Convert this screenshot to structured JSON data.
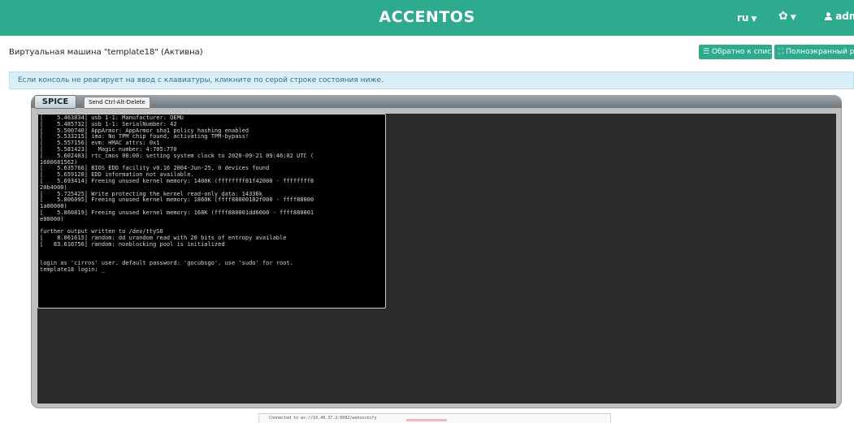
{
  "header": {
    "brand": "ACCENTOS",
    "lang": "ru",
    "caret": "▼",
    "gear": "✿",
    "user": "admi",
    "user_icon": "user-icon"
  },
  "page": {
    "title": "Виртуальная машина \"template18\" (Активна)",
    "back_button": "☰ Обратно к списку",
    "fullscreen_button": "⛶ Полноэкранный режим"
  },
  "alert": {
    "text": "Если консоль не реагирует на ввод с клавиатуры, кликните по серой строке состояния ниже."
  },
  "spice": {
    "logo": "SPICE",
    "cad_label": "Send Ctrl-Alt-Delete"
  },
  "console": {
    "lines": [
      "[    5.463834] usb 1-1: Manufacturer: QEMU",
      "[    5.485732] usb 1-1: SerialNumber: 42",
      "[    5.500740] AppArmor: AppArmor sha1 policy hashing enabled",
      "[    5.533215] ima: No TPM chip found, activating TPM-bypass!",
      "[    5.557156] evm: HMAC attrs: 0x1",
      "[    5.581423]   Magic number: 4:705:770",
      "[    5.602403] rtc_cmos 00:00: setting system clock to 2020-09-21 09:46:02 UTC (",
      "1600681562)",
      "[    5.635766] BIOS EDD facility v0.16 2004-Jun-25, 0 devices found",
      "[    5.659128] EDD information not available.",
      "[    5.693414] Freeing unused kernel memory: 1400K (ffffffff81f42000 - ffffffff8",
      "20b4000)",
      "[    5.725425] Write protecting the kernel read-only data: 14336k",
      "[    5.806095] Freeing unused kernel memory: 1860K (ffff88000182f000 - ffff88000",
      "1a00000)",
      "[    5.860819] Freeing unused kernel memory: 168K (ffff880001dd6000 - ffff880001",
      "e00000)",
      "",
      "further output written to /dev/ttyS0",
      "[    8.061615] random: dd urandom read with 20 bits of entropy available",
      "[   83.610756] random: nonblocking pool is initialized",
      "",
      "",
      "login as 'cirros' user. default password: 'gocubsgo'. use 'sudo' for root.",
      "template18 login: _"
    ]
  },
  "status": {
    "text": "Connected to ws://10.40.37.2:6082/websockify"
  }
}
